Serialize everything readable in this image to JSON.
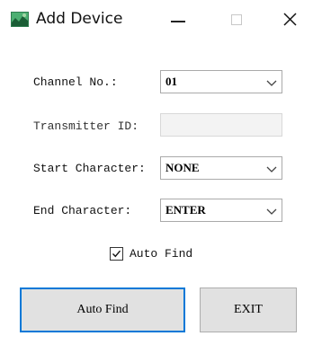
{
  "window": {
    "title": "Add Device",
    "minimize_glyph": "minimize-icon",
    "maximize_glyph": "maximize-icon",
    "close_glyph": "×"
  },
  "form": {
    "channel": {
      "label": "Channel No.:",
      "value": "01"
    },
    "transmitter": {
      "label": "Transmitter ID:",
      "value": ""
    },
    "start_char": {
      "label": "Start Character:",
      "value": "NONE"
    },
    "end_char": {
      "label": "End Character:",
      "value": "ENTER"
    },
    "auto_find_checkbox": {
      "label": "Auto Find",
      "checked": true
    }
  },
  "buttons": {
    "auto_find": "Auto Find",
    "exit": "EXIT"
  },
  "colors": {
    "focus_border": "#0078d7",
    "button_bg": "#e1e1e1"
  }
}
